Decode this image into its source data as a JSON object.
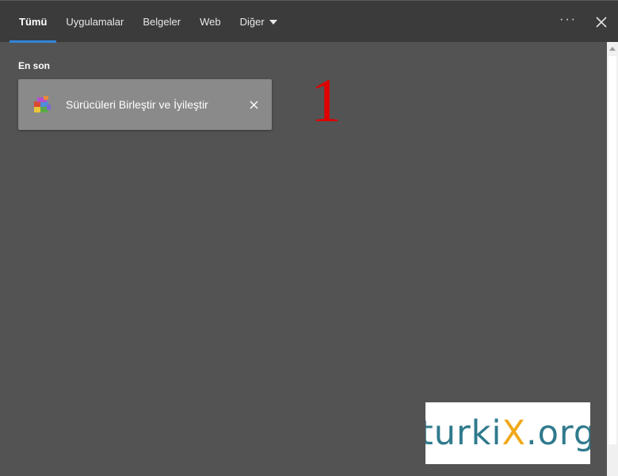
{
  "tabs": [
    {
      "label": "Tümü",
      "active": true
    },
    {
      "label": "Uygulamalar",
      "active": false
    },
    {
      "label": "Belgeler",
      "active": false
    },
    {
      "label": "Web",
      "active": false
    },
    {
      "label": "Diğer",
      "active": false
    }
  ],
  "actions": {
    "more_icon": "more-horizontal-icon",
    "close_icon": "close-icon"
  },
  "recent": {
    "title": "En son",
    "items": [
      {
        "label": "Sürücüleri Birleştir ve İyileştir",
        "icon": "defrag-app-icon"
      }
    ]
  },
  "annotation": {
    "number": "1",
    "color": "#e00000"
  },
  "watermark": {
    "text_prefix": "turki",
    "text_x": "X",
    "text_suffix": ".org"
  },
  "colors": {
    "accent": "#2f86d6",
    "background": "#535353",
    "topbar": "#3b3b3b",
    "item": "#8a8a8a"
  }
}
